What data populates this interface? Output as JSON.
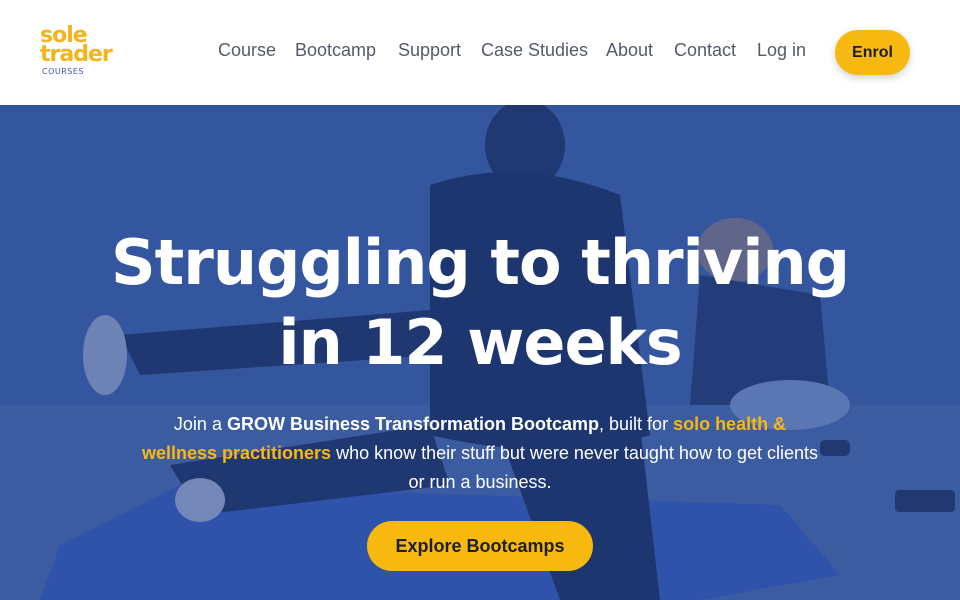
{
  "brand": {
    "logo_line1": "sole",
    "logo_line2": "trader",
    "logo_line3": "COURSES",
    "accent_color": "#f7b90f",
    "logo_sub_color": "#3b5db8"
  },
  "nav": {
    "items": [
      {
        "label": "Course"
      },
      {
        "label": "Bootcamp"
      },
      {
        "label": "Support"
      },
      {
        "label": "Case Studies"
      },
      {
        "label": "About"
      },
      {
        "label": "Contact"
      },
      {
        "label": "Log in"
      }
    ],
    "cta_label": "Enrol"
  },
  "hero": {
    "title_line1": "Struggling to thriving",
    "title_line2": "in 12 weeks",
    "sub_part1": "Join a ",
    "sub_bold": "GROW Business Transformation Bootcamp",
    "sub_part2": ", built for ",
    "sub_highlight": "solo health & wellness practitioners",
    "sub_part3": " who know their stuff but were never taught how to get clients or run a business.",
    "cta_label": "Explore Bootcamps",
    "overlay_color": "#2446968c",
    "background_image": "fitness-trainer-exercise-photo"
  }
}
